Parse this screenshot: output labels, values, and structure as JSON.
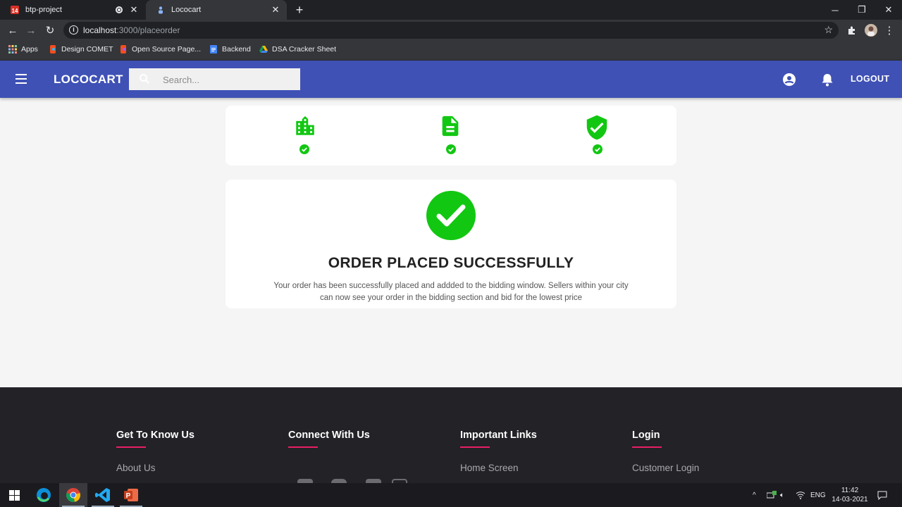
{
  "browser": {
    "tabs": [
      {
        "title": "btp-project",
        "active": false
      },
      {
        "title": "Lococart",
        "active": true
      }
    ],
    "url_host": "localhost",
    "url_path": ":3000/placeorder",
    "bookmarks": [
      "Apps",
      "Design COMET",
      "Open Source Page...",
      "Backend",
      "DSA Cracker Sheet"
    ]
  },
  "header": {
    "brand": "LOCOCART",
    "search_placeholder": "Search...",
    "logout_label": "LOGOUT"
  },
  "steps": [
    {
      "icon": "building-icon",
      "done": true
    },
    {
      "icon": "document-icon",
      "done": true
    },
    {
      "icon": "shield-check-icon",
      "done": true
    }
  ],
  "success": {
    "title": "ORDER PLACED SUCCESSFULLY",
    "message_line1": "Your order has been successfully placed and addded to the bidding window. Sellers within your city",
    "message_line2": "can now see your order in the bidding section and bid for the lowest price"
  },
  "footer": {
    "columns": [
      {
        "heading": "Get To Know Us",
        "first_link": "About Us"
      },
      {
        "heading": "Connect With Us",
        "first_link": ""
      },
      {
        "heading": "Important Links",
        "first_link": "Home Screen"
      },
      {
        "heading": "Login",
        "first_link": "Customer Login"
      }
    ]
  },
  "taskbar": {
    "language": "ENG",
    "time": "11:42",
    "date": "14-03-2021"
  },
  "colors": {
    "appbar": "#3f51b5",
    "success_green": "#12c712",
    "footer_accent": "#e91e63"
  }
}
